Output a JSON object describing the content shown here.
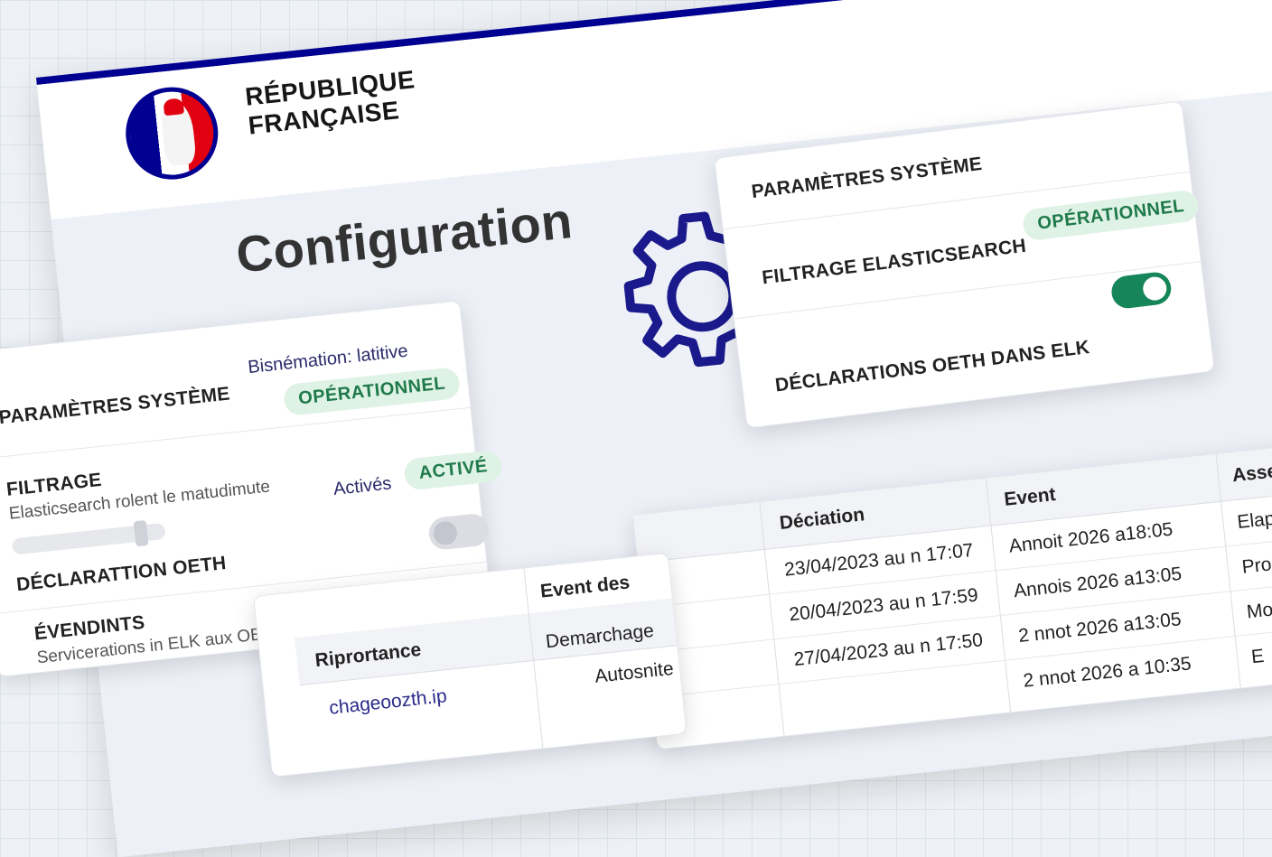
{
  "header": {
    "brand_line1": "RÉPUBLIQUE",
    "brand_line2": "FRANÇAISE"
  },
  "page": {
    "title": "Configuration"
  },
  "right_card": {
    "title": "PARAMÈTRES SYSTÈME",
    "rows": [
      {
        "label": "FILTRAGE ELASTICSEARCH",
        "badge": "OPÉRATIONNEL"
      },
      {
        "label": "DÉCLARATIONS  OETH DANS ELK",
        "toggle": true
      }
    ]
  },
  "left_card": {
    "title": "PARAMÈTRES SYSTÈME",
    "top_link": "Bisnémation: latitive",
    "status_badge": "OPÉRATIONNEL",
    "filter_label": "FILTRAGE",
    "filter_sub": "Elasticsearch rolent le matudimute",
    "active_link": "Activés",
    "active_badge": "ACTIVÉ",
    "declaration_label": "DÉCLARATTION OETH",
    "declaration_toggle": false,
    "events_label": "ÉVENDINTS",
    "events_sub": "Servicerations in ELK aux OETH"
  },
  "event_table": {
    "columns": [
      "Déciation",
      "Event",
      "Assen"
    ],
    "rows": [
      [
        "23/04/2023 au n 17:07",
        "Annoit 2026 a18:05",
        "Elapi"
      ],
      [
        "20/04/2023 au n 17:59",
        "Annois 2026 a13:05",
        "Pro"
      ],
      [
        "27/04/2023 au n 17:50",
        "2 nnot 2026 a13:05",
        "Mo"
      ],
      [
        "",
        "2 nnot 2026 a 10:35",
        "E"
      ]
    ]
  },
  "small_table": {
    "columns": [
      "Riprortance",
      "Event des"
    ],
    "rows": [
      [
        "chageoozth.ip",
        "Demarchage"
      ],
      [
        "",
        "Autosnite"
      ]
    ]
  },
  "colors": {
    "brand_blue": "#000091",
    "brand_red": "#e1000f",
    "success_bg": "#dff2e6",
    "success_text": "#1f7a4a",
    "toggle_on": "#16855a"
  },
  "icons": [
    "marianne-logo",
    "gear-icon"
  ]
}
